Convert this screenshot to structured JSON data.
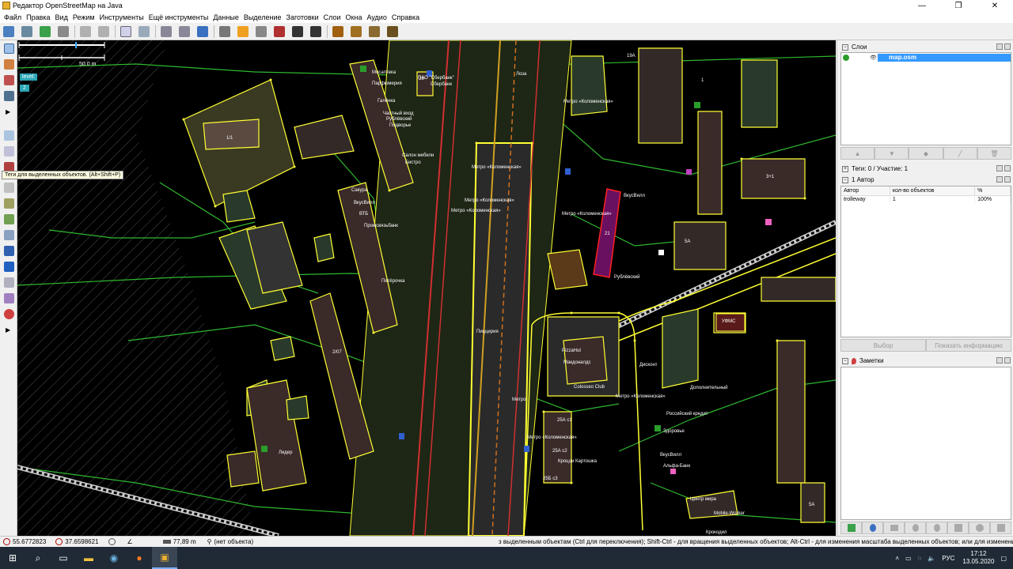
{
  "window": {
    "title": "Редактор OpenStreetMap на Java",
    "minimize": "—",
    "restore": "❐",
    "close": "✕"
  },
  "menu": [
    "Файл",
    "Правка",
    "Вид",
    "Режим",
    "Инструменты",
    "Ещё инструменты",
    "Данные",
    "Выделение",
    "Заготовки",
    "Слои",
    "Окна",
    "Аудио",
    "Справка"
  ],
  "map": {
    "scale": "50.0 m",
    "level_label": "level:",
    "level_value": "2",
    "labels": [
      "Мосаптека",
      "ПАО \"Сбербанк\"",
      "Сбербанк",
      "Парфюмерия",
      "Галёнка",
      "Частный вход",
      "Рублёвский",
      "Подворье",
      "Салон мебели",
      "Бистро",
      "Метро «Коломенская»",
      "Метро «Коломенская»",
      "Метро «Коломенская»",
      "Метро «Коломенская»",
      "Сакура",
      "ВкусВилл",
      "ВТБ",
      "Промсвязьбанк",
      "ВкусВилл",
      "Метро «Коломенская»",
      "Рублёвский",
      "Пятёрочка",
      "Пиццерия",
      "PizzaHut",
      "Colosseo Club",
      "Макдоналдс",
      "Метро «Коломенская»",
      "Метро",
      "25А с1",
      "25А с2",
      "25Б с3",
      "Кроцци Картошка",
      "Метро «Коломенская»",
      "Лидер",
      "Дисконт",
      "Дополнительный",
      "Российский кредит",
      "Здоровье",
      "ВкусВилл",
      "Альфа-Банк",
      "Центр мира",
      "Mobile-Worker",
      "Крокодил",
      "УФМС",
      "5А",
      "3+1",
      "1",
      "19А",
      "Лоза",
      "2/07",
      "1/1",
      "28",
      "21",
      "5А"
    ]
  },
  "tooltip": "Теги для выделенных объектов. (Alt+Shift+P)",
  "panels": {
    "layers": {
      "title": "Слои",
      "layer_name": "map.osm",
      "buttons": [
        "▲",
        "▼",
        "◆",
        "╱",
        "🗑"
      ]
    },
    "tags": {
      "title": "Теги: 0 / Участие: 1",
      "author_section": "1 Автор",
      "columns": [
        "Автор",
        "кол-во объектов",
        "%"
      ],
      "rows": [
        {
          "author": "trolleway",
          "count": "1",
          "percent": "100%"
        }
      ],
      "select_button": "Выбор",
      "info_button": "Показать информацию"
    },
    "notes": {
      "title": "Заметки"
    }
  },
  "status": {
    "lat": "55.6772823",
    "lon": "37.6598621",
    "distance": "77,89 m",
    "object": "(нет объекта)",
    "help": "з выделенным объектам (Ctrl для переключения); Shift-Ctrl - для вращения выделенных объектов; Alt-Ctrl - для изменения масштаба выделенных объектов; или для изменения выделения"
  },
  "taskbar": {
    "lang": "РУС",
    "time": "17:12",
    "date": "13.05.2020"
  },
  "colors": {
    "map_bg": "#000000",
    "building_outline": "#ffff00",
    "road_green": "#33cc33",
    "tram_red": "#d03030",
    "selected_building": "#c000c0",
    "layer_highlight": "#3399ff"
  }
}
